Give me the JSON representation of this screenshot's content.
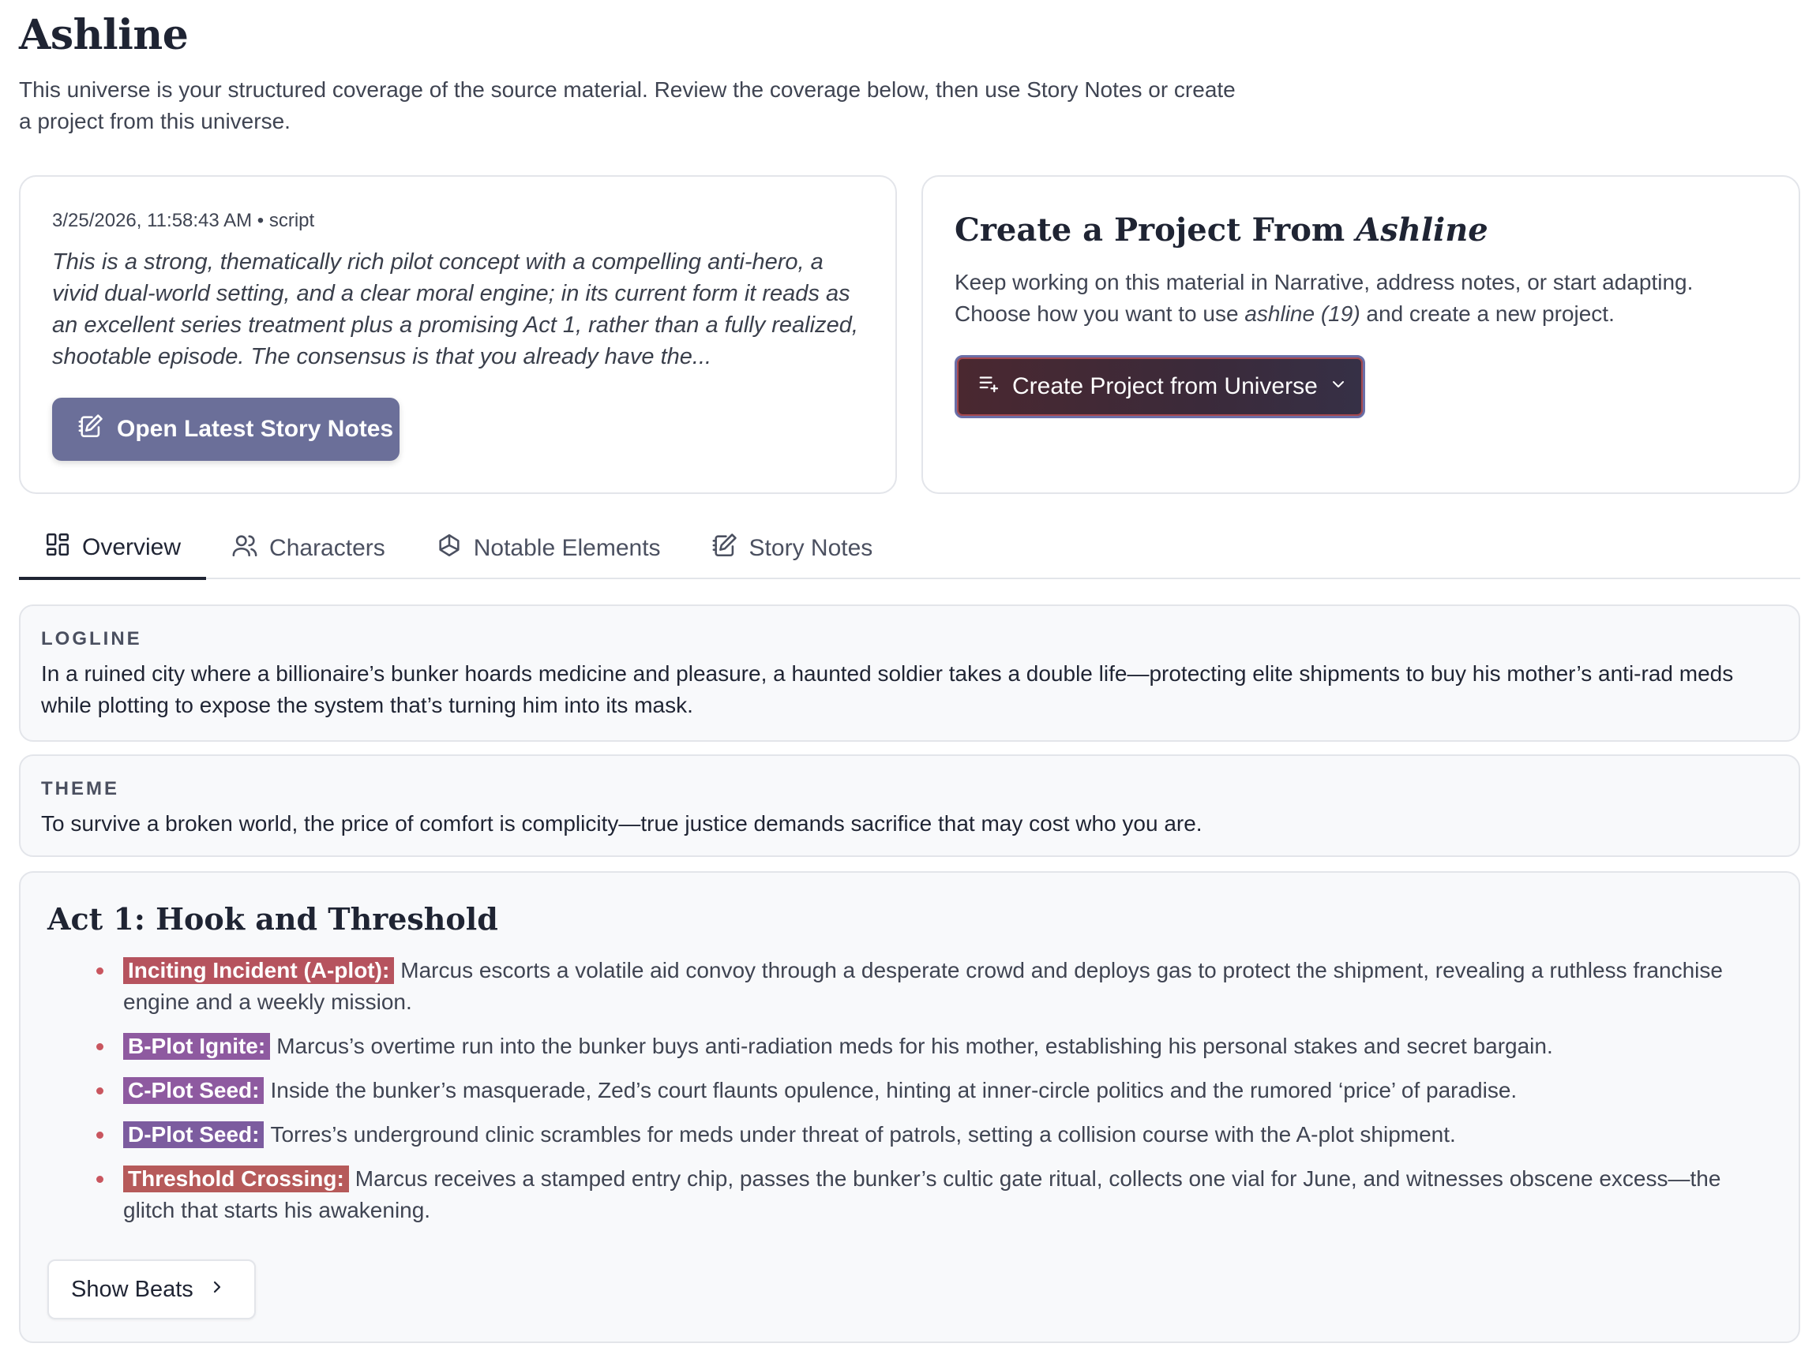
{
  "page": {
    "title": "Ashline",
    "intro": "This universe is your structured coverage of the source material. Review the coverage below, then use Story Notes or create a project from this universe."
  },
  "latest_notes": {
    "meta": "3/25/2026, 11:58:43 AM • script",
    "summary": "This is a strong, thematically rich pilot concept with a compelling anti-hero, a vivid dual-world setting, and a clear moral engine; in its current form it reads as an excellent series treatment plus a promising Act 1, rather than a fully realized, shootable episode. The consensus is that you already have the...",
    "button_label": "Open Latest Story Notes"
  },
  "create_project": {
    "title_prefix": "Create a Project From ",
    "title_name": "Ashline",
    "desc_line1": "Keep working on this material in Narrative, address notes, or start adapting.",
    "desc_line2_prefix": "Choose how you want to use ",
    "desc_line2_source": "ashline (19)",
    "desc_line2_suffix": " and create a new project.",
    "button_label": "Create Project from Universe"
  },
  "tabs": [
    {
      "label": "Overview",
      "icon": "grid-icon",
      "active": true
    },
    {
      "label": "Characters",
      "icon": "users-icon",
      "active": false
    },
    {
      "label": "Notable Elements",
      "icon": "shapes-icon",
      "active": false
    },
    {
      "label": "Story Notes",
      "icon": "notes-icon",
      "active": false
    }
  ],
  "logline": {
    "label": "LOGLINE",
    "text": "In a ruined city where a billionaire’s bunker hoards medicine and pleasure, a haunted soldier takes a double life—protecting elite shipments to buy his mother’s anti-rad meds while plotting to expose the system that’s turning him into its mask."
  },
  "theme": {
    "label": "THEME",
    "text": "To survive a broken world, the price of comfort is complicity—true justice demands sacrifice that may cost who you are."
  },
  "act1": {
    "title": "Act 1: Hook and Threshold",
    "beats": [
      {
        "tag": "Inciting Incident (A-plot):",
        "text": "Marcus escorts a volatile aid convoy through a desperate crowd and deploys gas to protect the shipment, revealing a ruthless franchise engine and a weekly mission.",
        "color": "#b6535e"
      },
      {
        "tag": "B-Plot Ignite:",
        "text": "Marcus’s overtime run into the bunker buys anti-radiation meds for his mother, establishing his personal stakes and secret bargain.",
        "color": "#8e5aa0"
      },
      {
        "tag": "C-Plot Seed:",
        "text": "Inside the bunker’s masquerade, Zed’s court flaunts opulence, hinting at inner-circle politics and the rumored ‘price’ of paradise.",
        "color": "#8e5aa0"
      },
      {
        "tag": "D-Plot Seed:",
        "text": "Torres’s underground clinic scrambles for meds under threat of patrols, setting a collision course with the A-plot shipment.",
        "color": "#7c5c9f"
      },
      {
        "tag": "Threshold Crossing:",
        "text": "Marcus receives a stamped entry chip, passes the bunker’s cultic gate ritual, collects one vial for June, and witnesses obscene excess—the glitch that starts his awakening.",
        "color": "#b65a5a"
      }
    ],
    "show_beats_label": "Show Beats"
  }
}
